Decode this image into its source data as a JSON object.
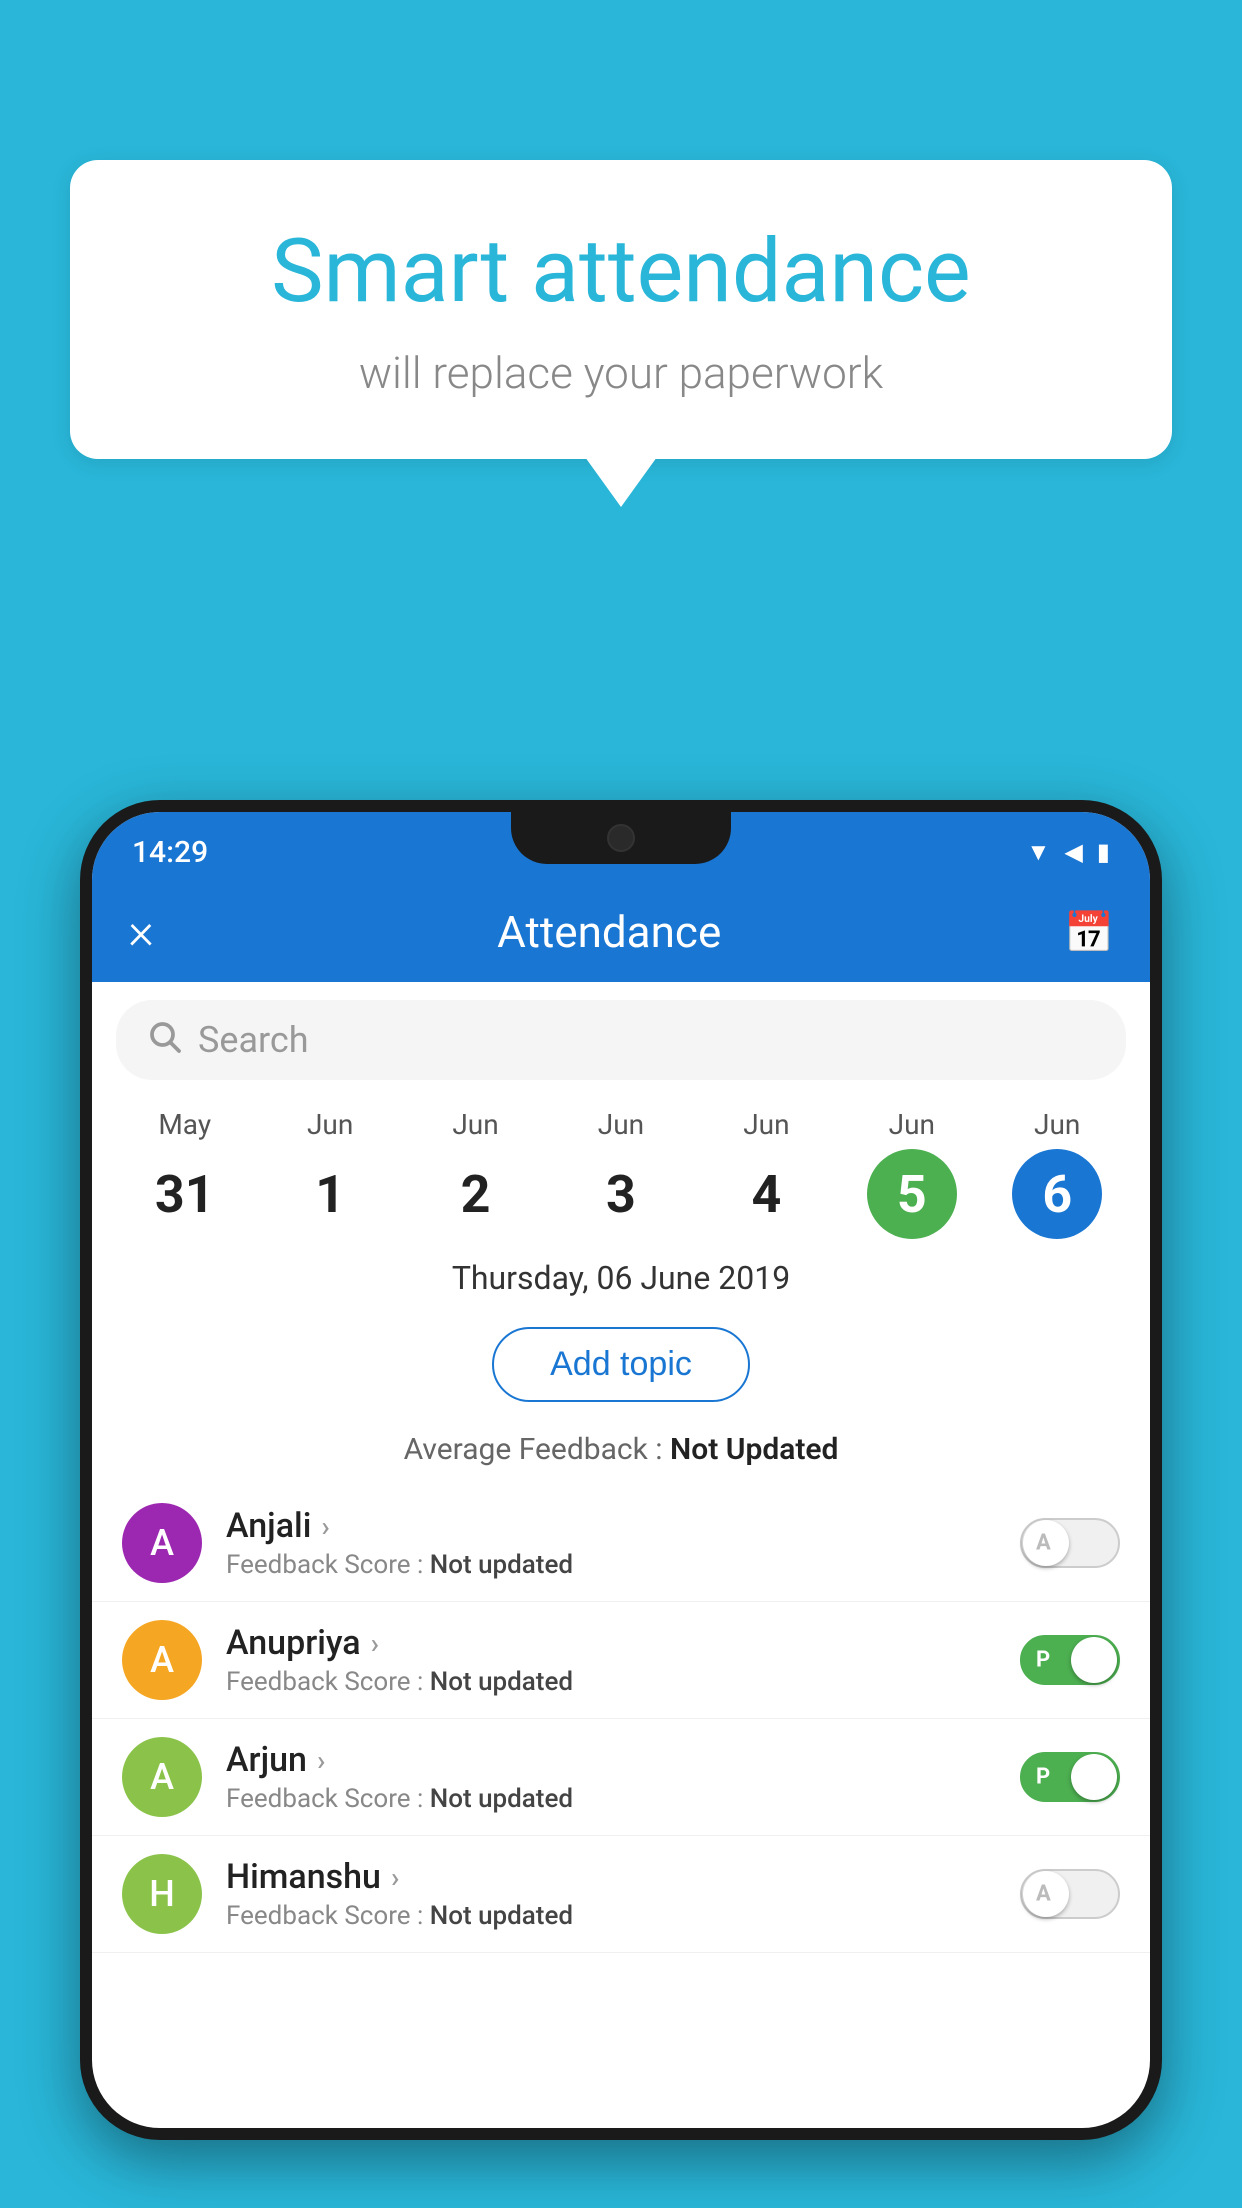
{
  "background_color": "#29b6d8",
  "speech_bubble": {
    "title": "Smart attendance",
    "subtitle": "will replace your paperwork"
  },
  "status_bar": {
    "time": "14:29",
    "icons": [
      "wifi",
      "signal",
      "battery"
    ]
  },
  "header": {
    "title": "Attendance",
    "close_label": "×",
    "calendar_icon": "📅"
  },
  "search": {
    "placeholder": "Search"
  },
  "calendar": {
    "days": [
      {
        "month": "May",
        "day": "31",
        "style": "plain"
      },
      {
        "month": "Jun",
        "day": "1",
        "style": "plain"
      },
      {
        "month": "Jun",
        "day": "2",
        "style": "plain"
      },
      {
        "month": "Jun",
        "day": "3",
        "style": "plain"
      },
      {
        "month": "Jun",
        "day": "4",
        "style": "plain"
      },
      {
        "month": "Jun",
        "day": "5",
        "style": "green"
      },
      {
        "month": "Jun",
        "day": "6",
        "style": "blue"
      }
    ]
  },
  "selected_date": "Thursday, 06 June 2019",
  "add_topic_label": "Add topic",
  "average_feedback_label": "Average Feedback :",
  "average_feedback_value": "Not Updated",
  "students": [
    {
      "name": "Anjali",
      "avatar_letter": "A",
      "avatar_color": "#9c27b0",
      "feedback": "Not updated",
      "toggle": "off",
      "toggle_letter": "A"
    },
    {
      "name": "Anupriya",
      "avatar_letter": "A",
      "avatar_color": "#f5a623",
      "feedback": "Not updated",
      "toggle": "on",
      "toggle_letter": "P"
    },
    {
      "name": "Arjun",
      "avatar_letter": "A",
      "avatar_color": "#8bc34a",
      "feedback": "Not updated",
      "toggle": "on",
      "toggle_letter": "P"
    },
    {
      "name": "Himanshu",
      "avatar_letter": "H",
      "avatar_color": "#8bc34a",
      "feedback": "Not updated",
      "toggle": "off",
      "toggle_letter": "A"
    }
  ]
}
